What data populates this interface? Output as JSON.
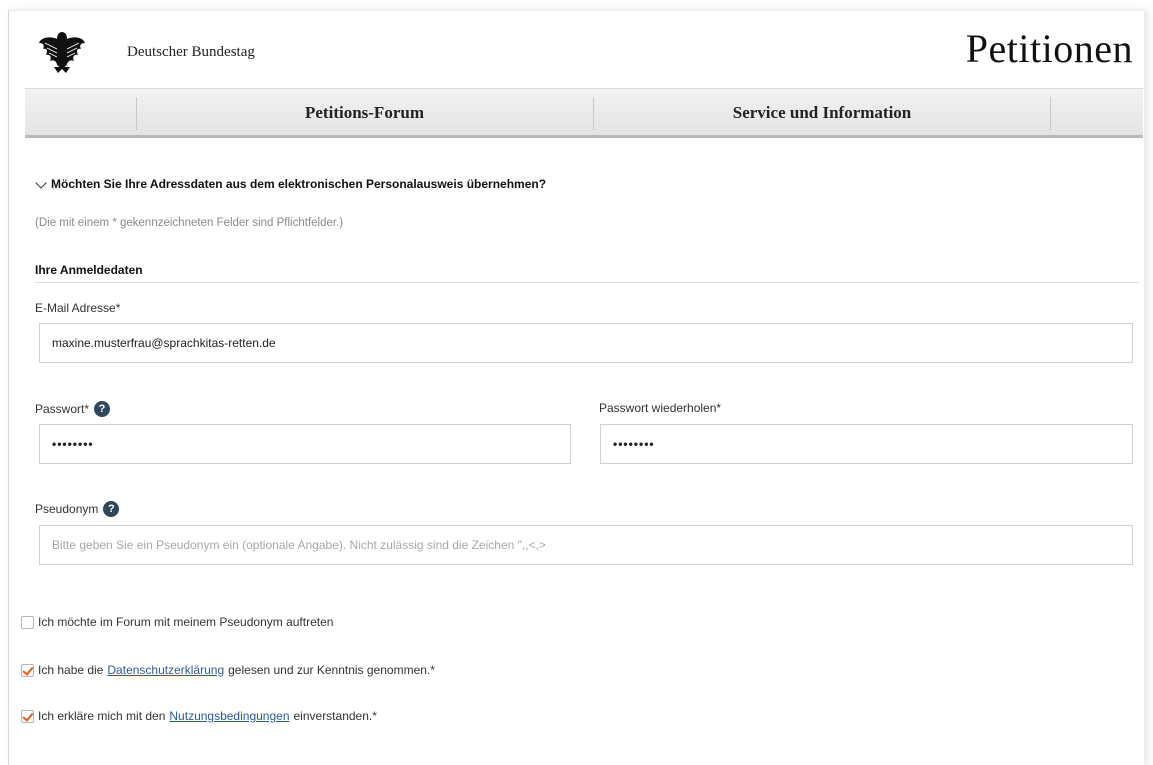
{
  "header": {
    "brand": "Deutscher Bundestag",
    "title": "Petitionen"
  },
  "nav": {
    "items": [
      {
        "label": "Petitions-Forum"
      },
      {
        "label": "Service und Information"
      }
    ]
  },
  "form": {
    "eid_toggle": "Möchten Sie Ihre Adressdaten aus dem elektronischen Personalausweis übernehmen?",
    "required_hint": "(Die mit einem * gekennzeichneten Felder sind Pflichtfelder.)",
    "section_title": "Ihre Anmeldedaten",
    "email": {
      "label": "E-Mail Adresse*",
      "value": "maxine.musterfrau@sprachkitas-retten.de"
    },
    "password": {
      "label": "Passwort*",
      "value": "••••••••"
    },
    "password_repeat": {
      "label": "Passwort wiederholen*",
      "value": "••••••••"
    },
    "pseudonym": {
      "label": "Pseudonym",
      "placeholder": "Bitte geben Sie ein Pseudonym ein (optionale Angabe). Nicht zulässig sind die Zeichen \",,<,>"
    },
    "help_glyph": "?",
    "checkboxes": {
      "pseudonym_use": {
        "text": "Ich möchte im Forum mit meinem Pseudonym auftreten",
        "checked": false
      },
      "privacy": {
        "before": "Ich habe die",
        "link": "Datenschutzerklärung",
        "after": "gelesen und zur Kenntnis genommen.*",
        "checked": true
      },
      "terms": {
        "before": "Ich erkläre mich mit den",
        "link": "Nutzungsbedingungen",
        "after": "einverstanden.*",
        "checked": true
      }
    }
  },
  "colors": {
    "checkmark": "#e05a1e",
    "link": "#2a5b96",
    "help_icon": "#2f4759"
  }
}
